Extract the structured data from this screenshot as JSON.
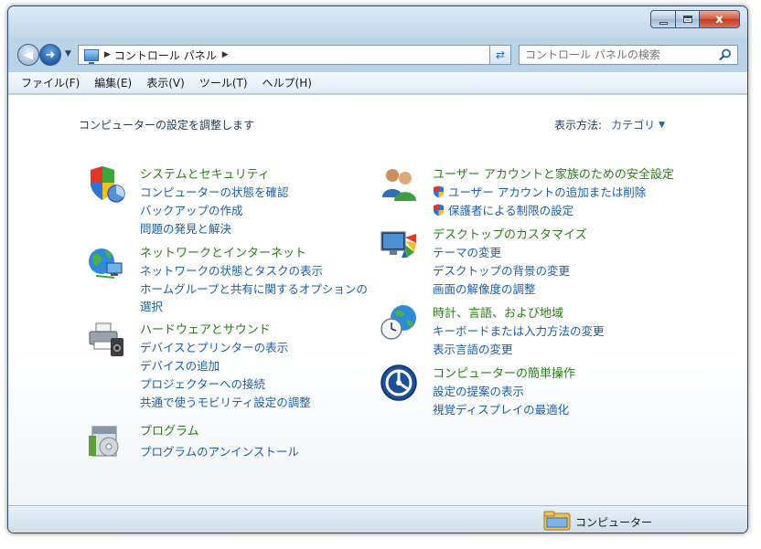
{
  "window": {
    "minimize_label": "",
    "maximize_label": "",
    "close_label": "x"
  },
  "navigation": {
    "address_path": "コントロール パネル",
    "search_placeholder": "コントロール パネルの検索"
  },
  "menu": [
    {
      "label": "ファイル(F)"
    },
    {
      "label": "編集(E)"
    },
    {
      "label": "表示(V)"
    },
    {
      "label": "ツール(T)"
    },
    {
      "label": "ヘルプ(H)"
    }
  ],
  "content": {
    "title": "コンピューターの設定を調整します",
    "view_label": "表示方法:",
    "view_value": "カテゴリ"
  },
  "categories": {
    "system": {
      "title": "システムとセキュリティ",
      "links": [
        "コンピューターの状態を確認",
        "バックアップの作成",
        "問題の発見と解決"
      ],
      "icon": "shield-icon"
    },
    "network": {
      "title": "ネットワークとインターネット",
      "links": [
        "ネットワークの状態とタスクの表示",
        "ホームグループと共有に関するオプションの",
        "選択"
      ],
      "icon": "network-globe-icon"
    },
    "hardware": {
      "title": "ハードウェアとサウンド",
      "links": [
        "デバイスとプリンターの表示",
        "デバイスの追加",
        "プロジェクターへの接続",
        "共通で使うモビリティ設定の調整"
      ],
      "icon": "printer-speaker-icon"
    },
    "programs": {
      "title": "プログラム",
      "links": [
        "プログラムのアンインストール"
      ],
      "icon": "programs-box-icon"
    },
    "users": {
      "title": "ユーザー アカウントと家族のための安全設定",
      "links": [
        "ユーザー アカウントの追加または削除",
        "保護者による制限の設定"
      ],
      "icon": "users-icon"
    },
    "appearance": {
      "title": "デスクトップのカスタマイズ",
      "links": [
        "テーマの変更",
        "デスクトップの背景の変更",
        "画面の解像度の調整"
      ],
      "icon": "monitor-palette-icon"
    },
    "clock": {
      "title": "時計、言語、および地域",
      "links": [
        "キーボードまたは入力方法の変更",
        "表示言語の変更"
      ],
      "icon": "clock-globe-icon"
    },
    "ease": {
      "title": "コンピューターの簡単操作",
      "links": [
        "設定の提案の表示",
        "視覚ディスプレイの最適化"
      ],
      "icon": "ease-of-access-icon"
    }
  },
  "status": {
    "location": "コンピューター"
  },
  "colors": {
    "category_title": "#2a7d19",
    "link": "#1a5fae",
    "text": "#1e395b"
  }
}
